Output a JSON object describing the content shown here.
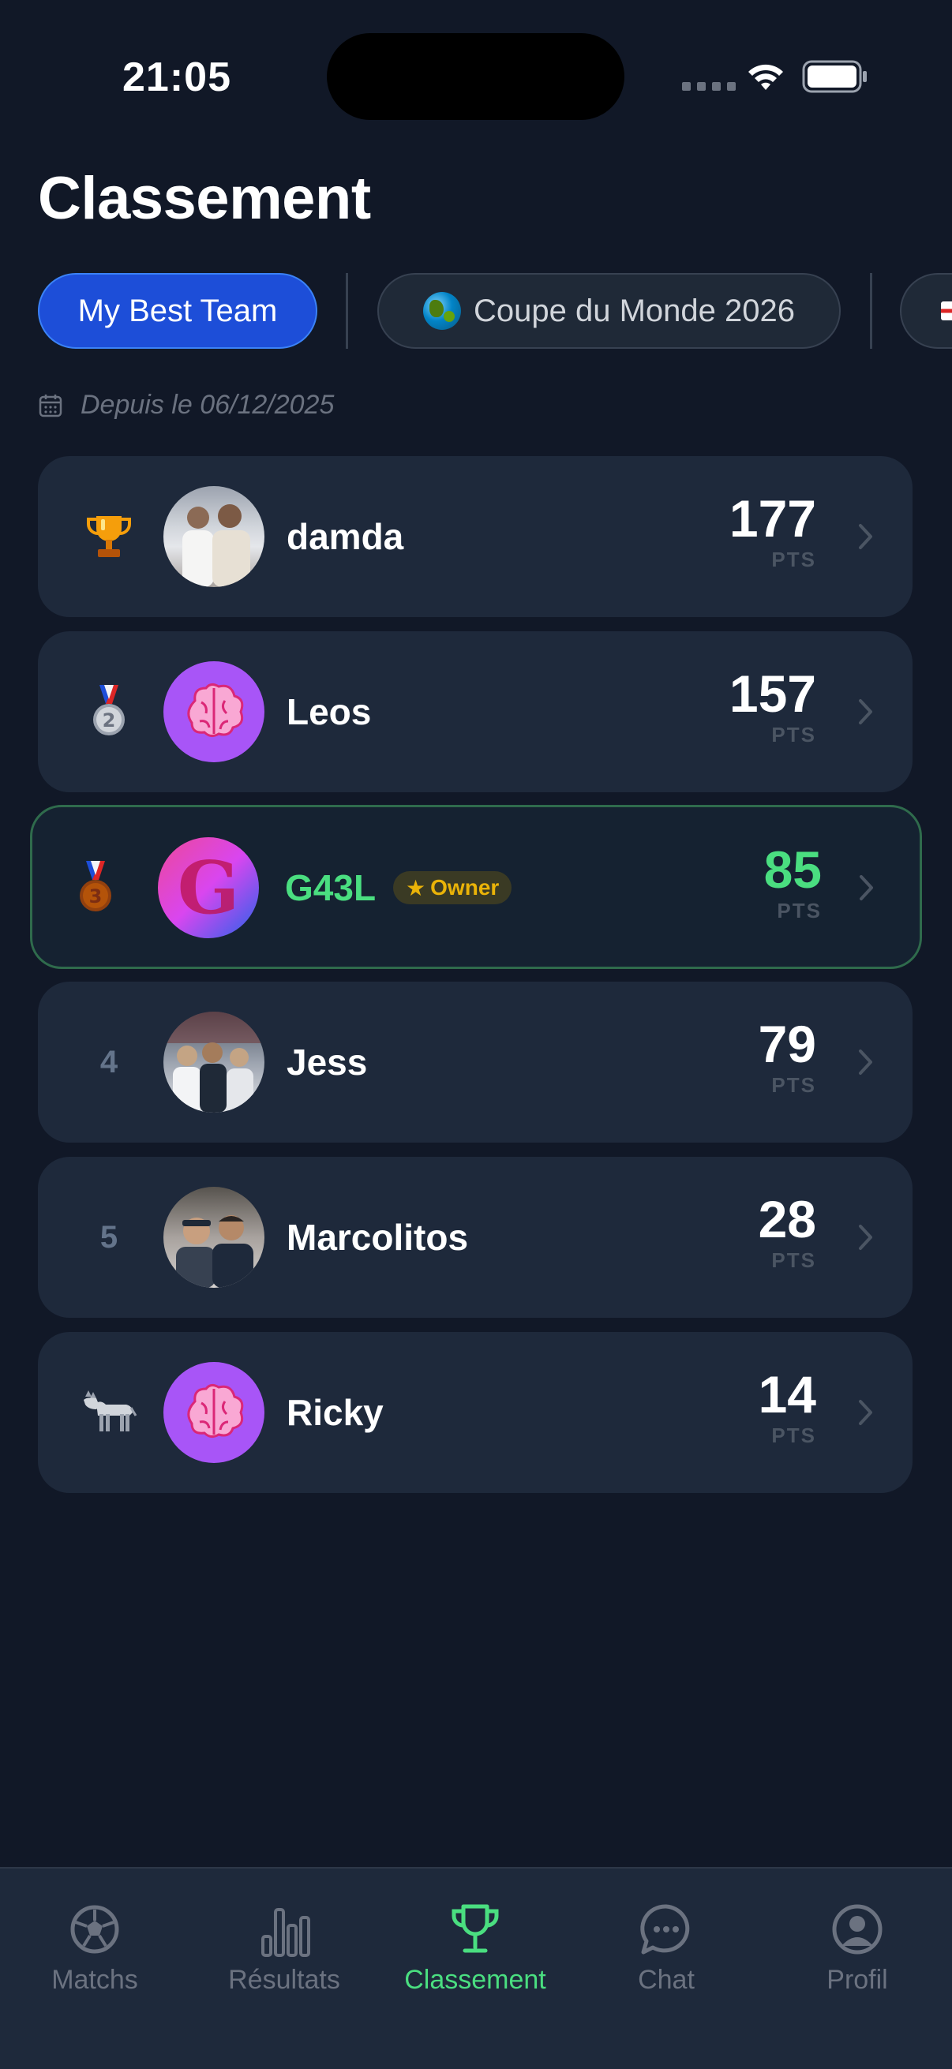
{
  "status_bar": {
    "time": "21:05"
  },
  "page": {
    "title": "Classement"
  },
  "tabs": [
    {
      "label": "My Best Team",
      "active": true
    },
    {
      "label": "Coupe du Monde 2026",
      "icon": "globe-icon",
      "active": false
    },
    {
      "label": "",
      "icon": "flag-icon",
      "active": false
    }
  ],
  "since": {
    "icon": "calendar-icon",
    "text": "Depuis le 06/12/2025"
  },
  "leaderboard": [
    {
      "rank": "",
      "rank_icon": "trophy-icon",
      "name": "damda",
      "points": "177",
      "pts_label": "PTS",
      "avatar": "photo"
    },
    {
      "rank": "",
      "rank_icon": "silver-medal-icon",
      "name": "Leos",
      "points": "157",
      "pts_label": "PTS",
      "avatar": "brain-icon"
    },
    {
      "rank": "",
      "rank_icon": "bronze-medal-icon",
      "name": "G43L",
      "badge": "Owner",
      "points": "85",
      "pts_label": "PTS",
      "avatar": "G-logo",
      "is_current_user": true
    },
    {
      "rank": "4",
      "name": "Jess",
      "points": "79",
      "pts_label": "PTS",
      "avatar": "photo"
    },
    {
      "rank": "5",
      "name": "Marcolitos",
      "points": "28",
      "pts_label": "PTS",
      "avatar": "photo"
    },
    {
      "rank": "",
      "rank_icon": "donkey-icon",
      "name": "Ricky",
      "points": "14",
      "pts_label": "PTS",
      "avatar": "brain-icon"
    }
  ],
  "tabbar": [
    {
      "label": "Matchs",
      "icon": "soccer-ball-icon",
      "active": false
    },
    {
      "label": "Résultats",
      "icon": "bar-chart-icon",
      "active": false
    },
    {
      "label": "Classement",
      "icon": "trophy-icon",
      "active": true
    },
    {
      "label": "Chat",
      "icon": "chat-bubble-icon",
      "active": false
    },
    {
      "label": "Profil",
      "icon": "user-circle-icon",
      "active": false
    }
  ],
  "colors": {
    "background": "#111827",
    "row": "#1e293b",
    "accent_blue": "#1d4ed8",
    "accent_green": "#4ade80",
    "owner_badge": "#eab308"
  }
}
